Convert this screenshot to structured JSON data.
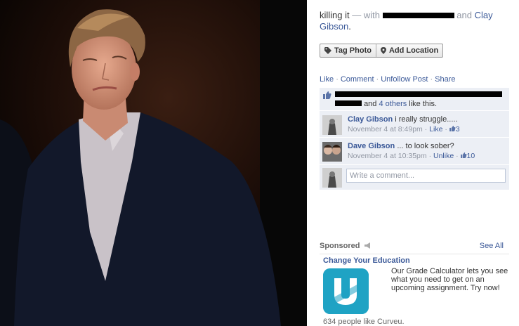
{
  "post": {
    "caption_text": "killing it",
    "caption_with": "— with",
    "caption_and": "and",
    "caption_tagged": "Clay Gibson",
    "caption_period": "."
  },
  "buttons": {
    "tag_photo": "Tag Photo",
    "add_location": "Add Location"
  },
  "actions": {
    "like": "Like",
    "comment": "Comment",
    "unfollow": "Unfollow Post",
    "share": "Share",
    "separator": "·"
  },
  "likes": {
    "and_text": "and",
    "others_link": "4 others",
    "suffix": "like this."
  },
  "comments": [
    {
      "name": "Clay Gibson",
      "text": "i really struggle.....",
      "time": "November 4 at 8:49pm",
      "action": "Like",
      "like_count": "3"
    },
    {
      "name": "Dave Gibson",
      "text": "... to look sober?",
      "time": "November 4 at 10:35pm",
      "action": "Unlike",
      "like_count": "10"
    }
  ],
  "write_comment": {
    "placeholder": "Write a comment..."
  },
  "sponsored": {
    "label": "Sponsored",
    "see_all": "See All",
    "ad_title": "Change Your Education",
    "ad_text": "Our Grade Calculator lets you see what you need to get on an upcoming assignment. Try now!",
    "ad_likes": "634 people like Curveu."
  },
  "colors": {
    "link": "#3b5998",
    "comment_bg": "#eceff5",
    "ad_logo": "#1fa3c4"
  }
}
